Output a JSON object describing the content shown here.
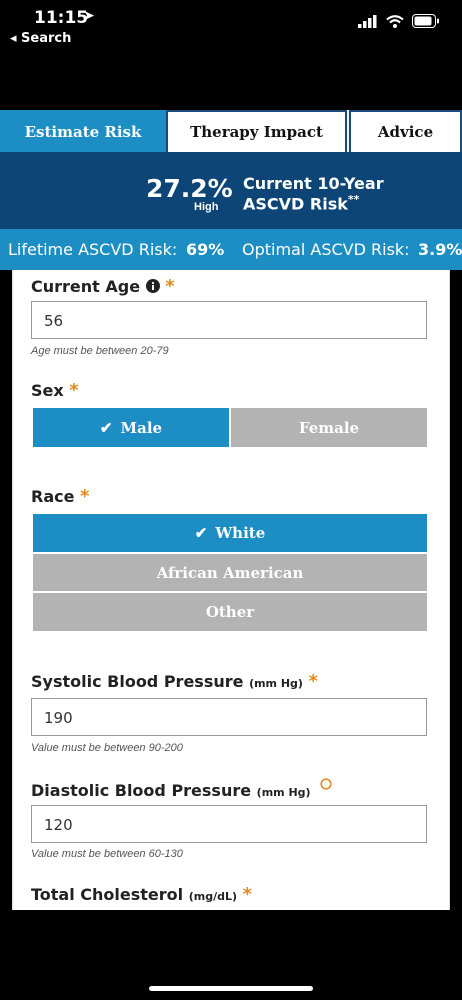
{
  "status": {
    "time": "11:15",
    "back_label": "◂ Search"
  },
  "tabs": [
    {
      "label": "Estimate Risk",
      "active": true
    },
    {
      "label": "Therapy Impact",
      "active": false
    },
    {
      "label": "Advice",
      "active": false
    }
  ],
  "risk": {
    "percent": "27.2%",
    "level": "High",
    "title_line1": "Current 10-Year",
    "title_line2": "ASCVD Risk",
    "title_mark": "**"
  },
  "lifetime": {
    "label": "Lifetime ASCVD Risk:",
    "value": "69%",
    "optimal_label": "Optimal ASCVD Risk:",
    "optimal_value": "3.9%"
  },
  "form": {
    "age": {
      "label": "Current Age",
      "value": "56",
      "hint": "Age must be between 20-79"
    },
    "sex": {
      "label": "Sex",
      "options": [
        "Male",
        "Female"
      ],
      "selected": "Male"
    },
    "race": {
      "label": "Race",
      "options": [
        "White",
        "African American",
        "Other"
      ],
      "selected": "White"
    },
    "systolic": {
      "label": "Systolic Blood Pressure",
      "unit": "(mm Hg)",
      "value": "190",
      "hint": "Value must be between 90-200"
    },
    "diastolic": {
      "label": "Diastolic Blood Pressure",
      "unit": "(mm Hg)",
      "value": "120",
      "hint": "Value must be between 60-130"
    },
    "cholesterol": {
      "label": "Total Cholesterol",
      "unit": "(mg/dL)"
    }
  },
  "colors": {
    "accent": "#1d8ec3",
    "navy": "#0d4577",
    "required": "#e38a1e",
    "unselected": "#b3b3b3"
  }
}
